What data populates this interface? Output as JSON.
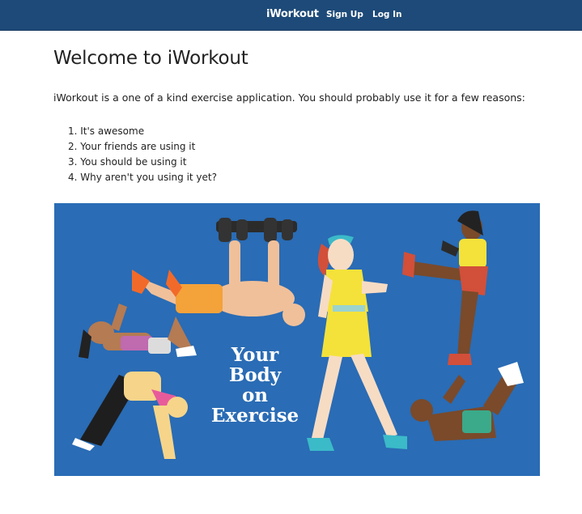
{
  "nav": {
    "brand": "iWorkout",
    "sign_up": "Sign Up",
    "log_in": "Log In",
    "background_color": "#1d4a78"
  },
  "main": {
    "title": "Welcome to iWorkout",
    "intro": "iWorkout is a one of a kind exercise application. You should probably use it for a few reasons:",
    "reasons": [
      "It's awesome",
      "Your friends are using it",
      "You should be using it",
      "Why aren't you using it yet?"
    ]
  },
  "hero": {
    "caption_lines": [
      "Your",
      "Body",
      "on",
      "Exercise"
    ],
    "background_color": "#2a6cb5",
    "illustration": "people-exercising-illustration"
  }
}
